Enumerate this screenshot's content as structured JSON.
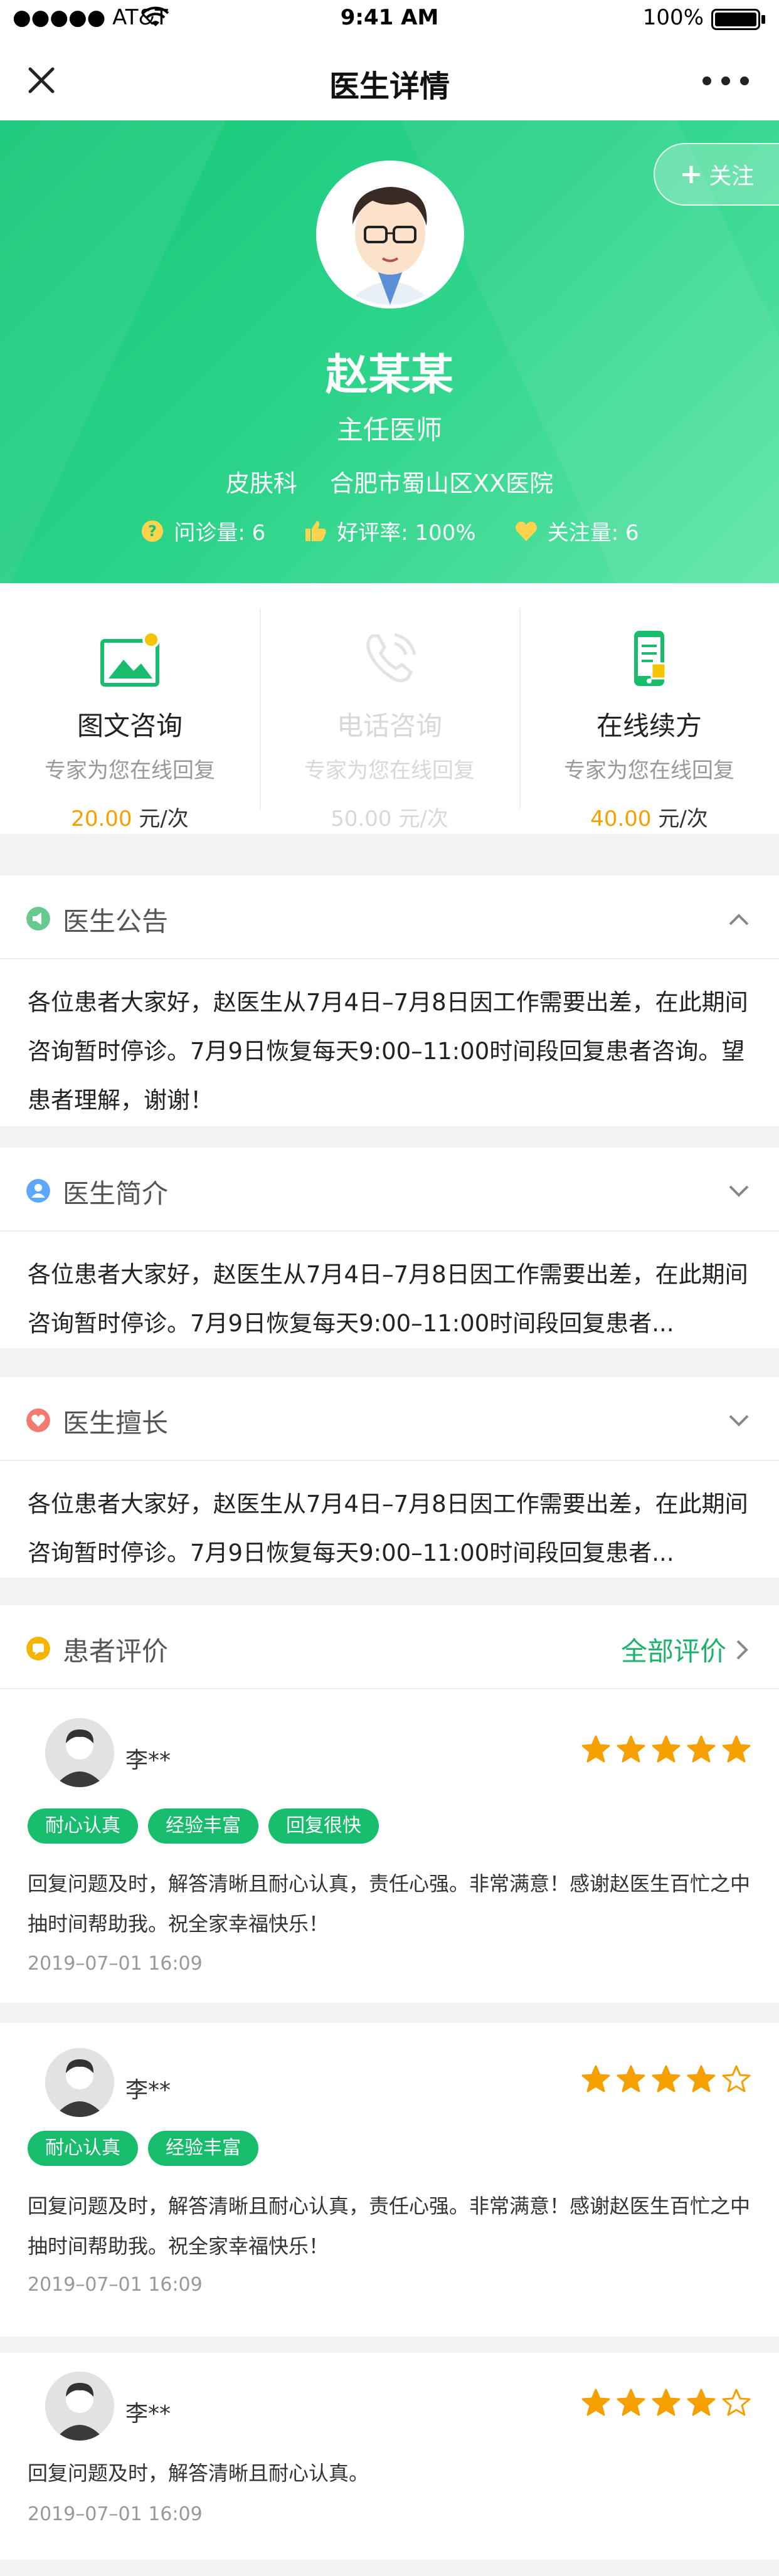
{
  "status_bar": {
    "carrier": "●●●●● AT&T",
    "time": "9:41 AM",
    "battery": "100%"
  },
  "nav": {
    "title": "医生详情"
  },
  "hero": {
    "follow_label": "关注",
    "name": "赵某某",
    "title": "主任医师",
    "department": "皮肤科",
    "hospital": "合肥市蜀山区XX医院",
    "stats": [
      {
        "label": "问诊量: 6",
        "icon": "question-icon"
      },
      {
        "label": "好评率: 100%",
        "icon": "thumbs-up-icon"
      },
      {
        "label": "关注量: 6",
        "icon": "heart-icon"
      }
    ]
  },
  "services": [
    {
      "name": "图文咨询",
      "desc": "专家为您在线回复",
      "price": "20.00",
      "unit": "元/次",
      "enabled": true,
      "icon": "image-chat-icon"
    },
    {
      "name": "电话咨询",
      "desc": "专家为您在线回复",
      "price": "50.00",
      "unit": "元/次",
      "enabled": false,
      "icon": "phone-icon"
    },
    {
      "name": "在线续方",
      "desc": "专家为您在线回复",
      "price": "40.00",
      "unit": "元/次",
      "enabled": true,
      "icon": "mobile-prescription-icon"
    }
  ],
  "sections": {
    "notice": {
      "title": "医生公告",
      "text": "各位患者大家好，赵医生从7月4日–7月8日因工作需要出差，在此期间咨询暂时停诊。7月9日恢复每天9:00–11:00时间段回复患者咨询。望患者理解，谢谢！"
    },
    "intro": {
      "title": "医生简介",
      "text": "各位患者大家好，赵医生从7月4日–7月8日因工作需要出差，在此期间咨询暂时停诊。7月9日恢复每天9:00–11:00时间段回复患者..."
    },
    "expertise": {
      "title": "医生擅长",
      "text": "各位患者大家好，赵医生从7月4日–7月8日因工作需要出差，在此期间咨询暂时停诊。7月9日恢复每天9:00–11:00时间段回复患者..."
    },
    "reviews": {
      "title": "患者评价",
      "all_label": "全部评价"
    }
  },
  "reviews": [
    {
      "name": "李**",
      "rating": 5,
      "tags": [
        "耐心认真",
        "经验丰富",
        "回复很快"
      ],
      "text": "回复问题及时，解答清晰且耐心认真，责任心强。非常满意！感谢赵医生百忙之中抽时间帮助我。祝全家幸福快乐！",
      "time": "2019–07–01   16:09"
    },
    {
      "name": "李**",
      "rating": 4,
      "tags": [
        "耐心认真",
        "经验丰富"
      ],
      "text": "回复问题及时，解答清晰且耐心认真，责任心强。非常满意！感谢赵医生百忙之中抽时间帮助我。祝全家幸福快乐！",
      "time": "2019–07–01   16:09"
    },
    {
      "name": "李**",
      "rating": 4,
      "tags": [],
      "text": "回复问题及时，解答清晰且耐心认真。",
      "time": "2019–07–01   16:09"
    }
  ],
  "colors": {
    "accent": "#17bd6c",
    "price": "#f5a000",
    "star": "#f5a000"
  }
}
